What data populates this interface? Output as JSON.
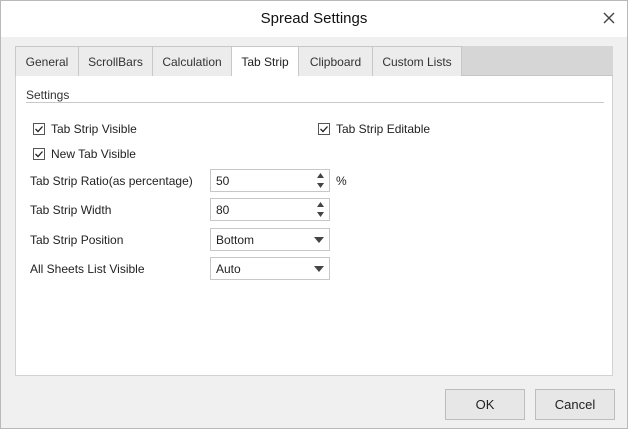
{
  "window": {
    "title": "Spread Settings",
    "close_icon": "close-icon"
  },
  "tabs": [
    {
      "label": "General"
    },
    {
      "label": "ScrollBars"
    },
    {
      "label": "Calculation"
    },
    {
      "label": "Tab Strip",
      "active": true
    },
    {
      "label": "Clipboard"
    },
    {
      "label": "Custom Lists"
    }
  ],
  "settings": {
    "group_title": "Settings",
    "tab_strip_visible": {
      "label": "Tab Strip Visible",
      "checked": true
    },
    "tab_strip_editable": {
      "label": "Tab Strip Editable",
      "checked": true
    },
    "new_tab_visible": {
      "label": "New Tab Visible",
      "checked": true
    },
    "ratio": {
      "label": "Tab Strip Ratio(as percentage)",
      "value": "50",
      "unit": "%"
    },
    "width": {
      "label": "Tab Strip Width",
      "value": "80"
    },
    "position": {
      "label": "Tab Strip Position",
      "value": "Bottom"
    },
    "all_sheets": {
      "label": "All Sheets List Visible",
      "value": "Auto"
    }
  },
  "buttons": {
    "ok": "OK",
    "cancel": "Cancel"
  },
  "colors": {
    "dialog_bg": "#f0f0f0",
    "tab_bar": "#d6d6d6",
    "panel_bg": "#ffffff"
  }
}
